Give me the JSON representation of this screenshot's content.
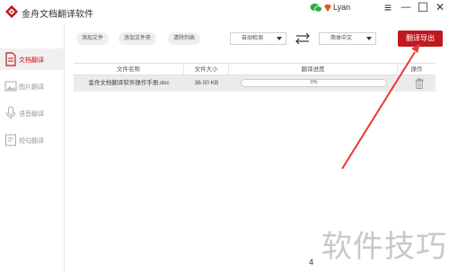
{
  "app": {
    "title": "金舟文档翻译软件"
  },
  "user": {
    "name": "Lyan"
  },
  "window": {
    "menu_icon": "≡",
    "minimize_icon": "—",
    "maximize_icon": "☐",
    "close_icon": "✕"
  },
  "sidebar": {
    "items": [
      {
        "label": "文档翻译",
        "icon": "document-icon",
        "active": true
      },
      {
        "label": "图片翻译",
        "icon": "image-icon",
        "active": false
      },
      {
        "label": "语音翻译",
        "icon": "microphone-icon",
        "active": false
      },
      {
        "label": "短句翻译",
        "icon": "text-icon",
        "active": false
      }
    ]
  },
  "toolbar": {
    "add_file": "添加文件",
    "add_folder": "添加文件夹",
    "clear_list": "清除列表",
    "source_lang": "自动检测",
    "target_lang": "简体中文",
    "export": "翻译导出"
  },
  "table": {
    "headers": [
      "文件名称",
      "文件大小",
      "翻译进度",
      "操作"
    ],
    "rows": [
      {
        "name": "金舟文档翻译软件操作手册.doc",
        "size": "36.00 KB",
        "progress": 0,
        "progress_text": "0%"
      }
    ]
  },
  "annotation": {
    "watermark": "软件技巧",
    "page_number": "4"
  },
  "colors": {
    "accent": "#c01820",
    "active_nav_bg": "#f0f0f0"
  }
}
